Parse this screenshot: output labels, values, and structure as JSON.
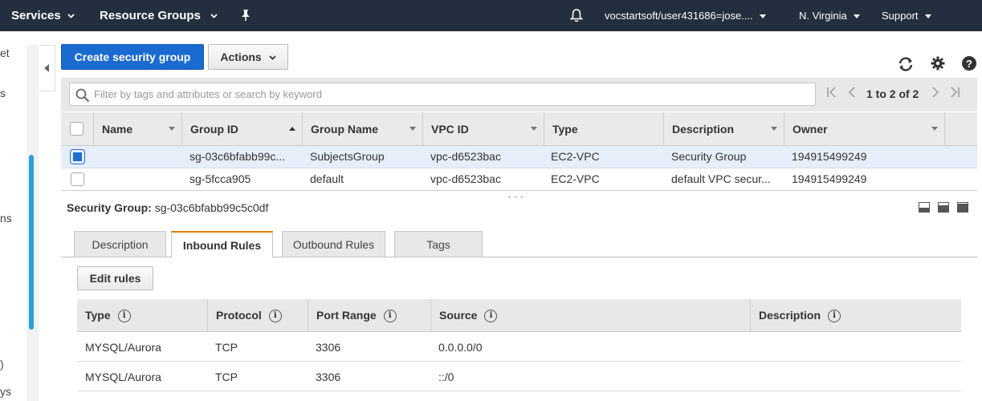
{
  "topnav": {
    "services": "Services",
    "resource_groups": "Resource Groups",
    "account": "vocstartsoft/user431686=jose....",
    "region": "N. Virginia",
    "support": "Support"
  },
  "sidebar": {
    "fragments": [
      "et",
      "s",
      "ns",
      ")",
      "ys"
    ]
  },
  "toolbar": {
    "create_label": "Create security group",
    "actions_label": "Actions"
  },
  "filter": {
    "placeholder": "Filter by tags and attributes or search by keyword",
    "pagination": "1 to 2 of 2"
  },
  "grid": {
    "columns": [
      "Name",
      "Group ID",
      "Group Name",
      "VPC ID",
      "Type",
      "Description",
      "Owner"
    ],
    "rows": [
      {
        "selected": true,
        "name": "",
        "group_id": "sg-03c6bfabb99c...",
        "group_name": "SubjectsGroup",
        "vpc_id": "vpc-d6523bac",
        "type": "EC2-VPC",
        "description": "Security Group",
        "owner": "194915499249"
      },
      {
        "selected": false,
        "name": "",
        "group_id": "sg-5fcca905",
        "group_name": "default",
        "vpc_id": "vpc-d6523bac",
        "type": "EC2-VPC",
        "description": "default VPC secur...",
        "owner": "194915499249"
      }
    ]
  },
  "detail": {
    "label": "Security Group:",
    "value": "sg-03c6bfabb99c5c0df",
    "tabs": [
      "Description",
      "Inbound Rules",
      "Outbound Rules",
      "Tags"
    ],
    "active_tab": "Inbound Rules",
    "edit_rules_label": "Edit rules"
  },
  "rules": {
    "columns": [
      "Type",
      "Protocol",
      "Port Range",
      "Source",
      "Description"
    ],
    "rows": [
      {
        "type": "MYSQL/Aurora",
        "protocol": "TCP",
        "port_range": "3306",
        "source": "0.0.0.0/0",
        "description": ""
      },
      {
        "type": "MYSQL/Aurora",
        "protocol": "TCP",
        "port_range": "3306",
        "source": "::/0",
        "description": ""
      }
    ]
  },
  "colors": {
    "nav_bg": "#232f3e",
    "primary_button": "#1a6ad1",
    "active_tab_accent": "#e07b00",
    "selected_row": "#e6eefa"
  }
}
